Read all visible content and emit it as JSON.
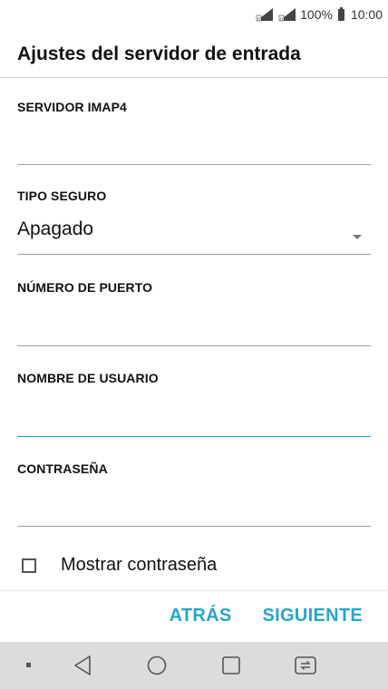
{
  "status_bar": {
    "battery": "100%",
    "time": "10:00",
    "icons": [
      "signal-sim1-icon",
      "signal-sim2-icon",
      "battery-icon"
    ]
  },
  "app_bar": {
    "title": "Ajustes del servidor de entrada"
  },
  "form": {
    "imap_server": {
      "label": "SERVIDOR IMAP4",
      "value": ""
    },
    "security_type": {
      "label": "TIPO SEGURO",
      "value": "Apagado"
    },
    "port": {
      "label": "NÚMERO DE PUERTO",
      "value": ""
    },
    "username": {
      "label": "NOMBRE DE USUARIO",
      "value": ""
    },
    "password": {
      "label": "CONTRASEÑA",
      "value": ""
    }
  },
  "show_password": {
    "label": "Mostrar contraseña",
    "checked": false
  },
  "actions": {
    "back": "ATRÁS",
    "next": "SIGUIENTE"
  },
  "colors": {
    "accent": "#25a6c9",
    "focus_line": "#1b9bd1",
    "navbar_bg": "#dcdcdc"
  },
  "navbar": {
    "icons": [
      "notification-dot-icon",
      "back-triangle-icon",
      "home-circle-icon",
      "recents-square-icon",
      "dual-window-icon"
    ]
  }
}
